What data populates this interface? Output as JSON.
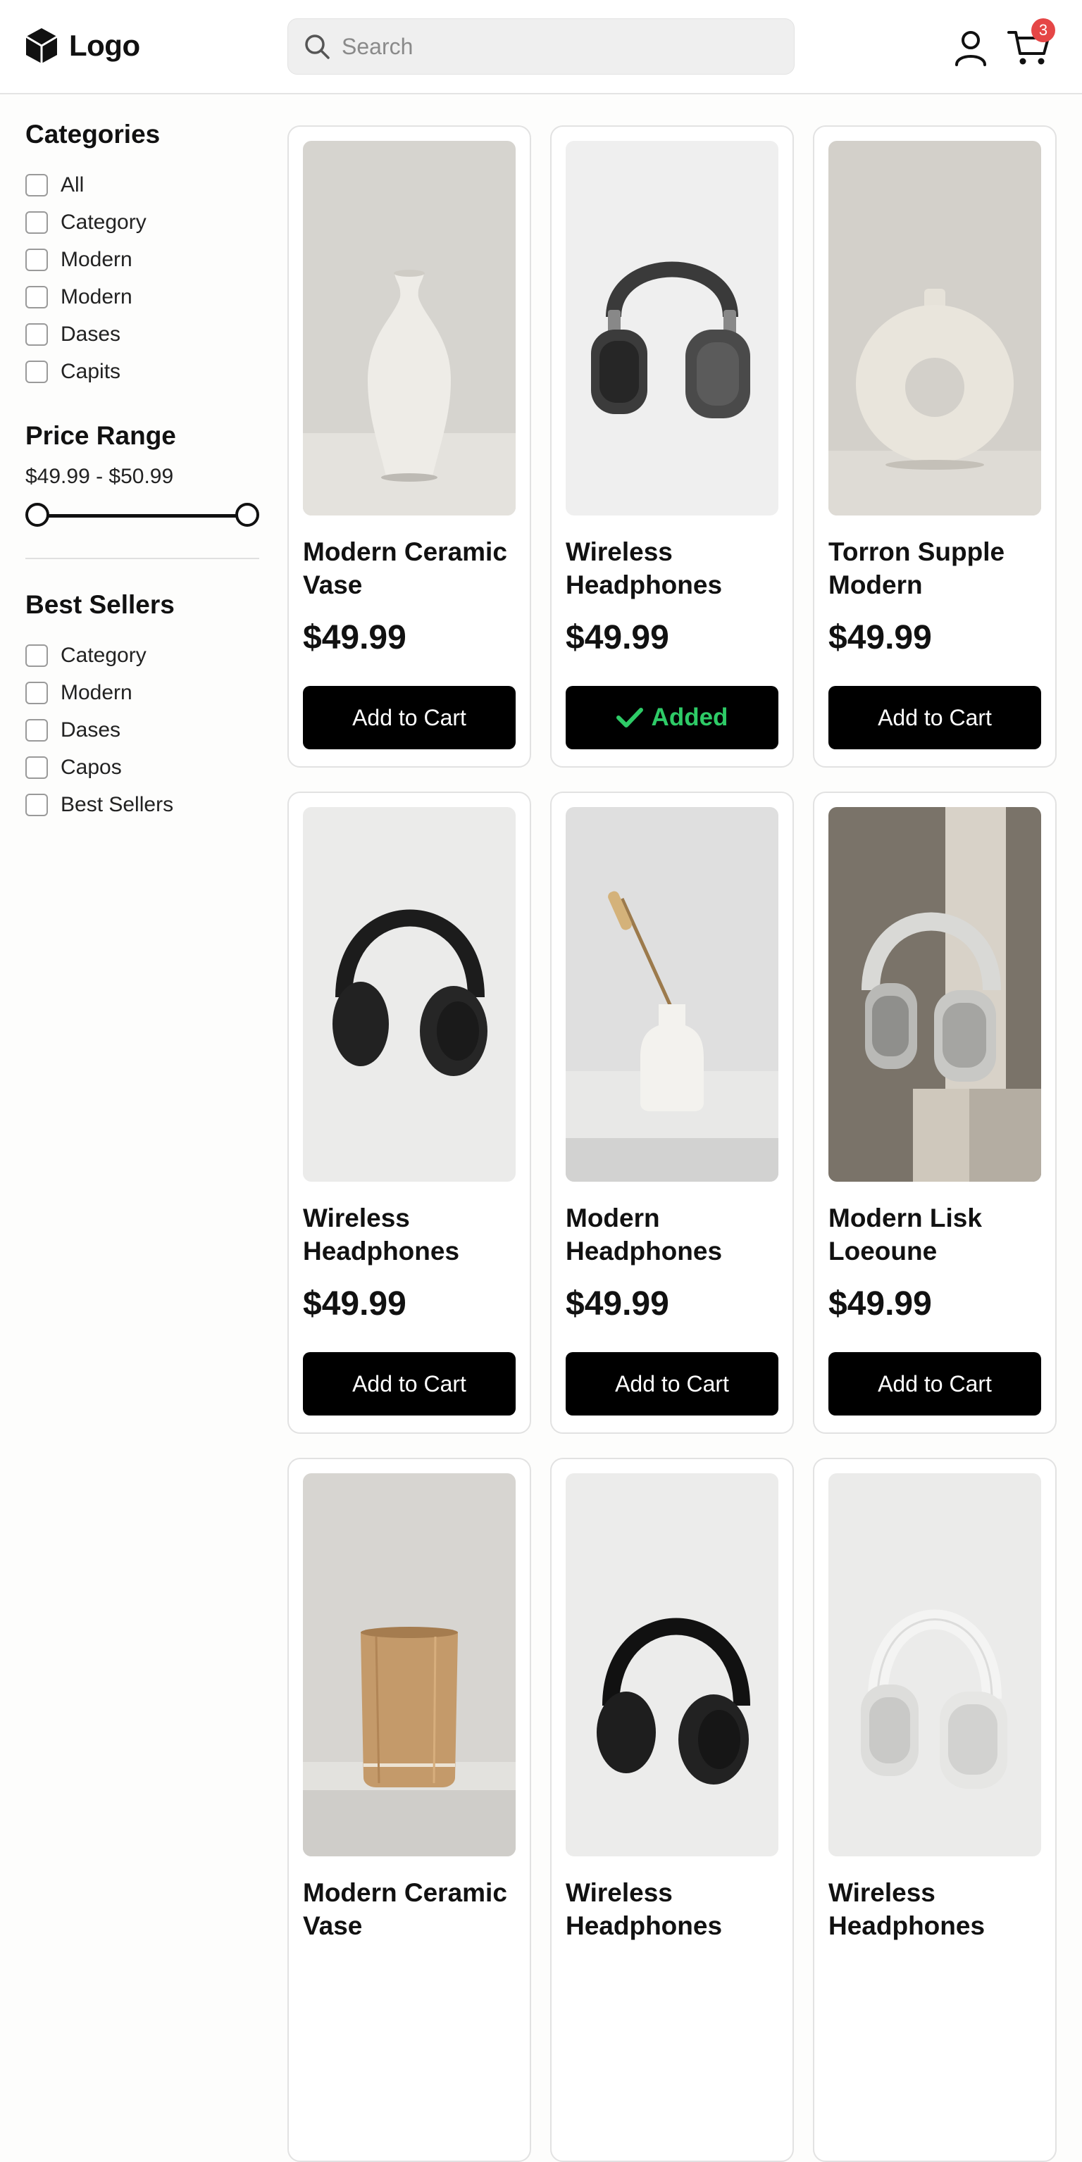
{
  "header": {
    "logo_text": "Logo",
    "search_placeholder": "Search",
    "cart_count": "3"
  },
  "sidebar": {
    "categories_title": "Categories",
    "categories": [
      "All",
      "Category",
      "Modern",
      "Modern",
      "Dases",
      "Capits"
    ],
    "price_title": "Price Range",
    "price_range": "$49.99 - $50.99",
    "best_sellers_title": "Best Sellers",
    "best_sellers": [
      "Category",
      "Modern",
      "Dases",
      "Capos",
      "Best Sellers"
    ]
  },
  "products": [
    {
      "name": "Modern Ceramic Vase",
      "price": "$49.99",
      "button": "Add to Cart",
      "image": "ceramic-vase"
    },
    {
      "name": "Wireless Headphones",
      "price": "$49.99",
      "button": "Added",
      "image": "headphones-dark-gray"
    },
    {
      "name": "Torron Supple Modern",
      "price": "$49.99",
      "button": "Add to Cart",
      "image": "donut-vase"
    },
    {
      "name": "Wireless Headphones",
      "price": "$49.99",
      "button": "Add to Cart",
      "image": "headphones-black"
    },
    {
      "name": "Modern Headphones",
      "price": "$49.99",
      "button": "Add to Cart",
      "image": "diffuser-vase"
    },
    {
      "name": "Modern Lisk Loeoune",
      "price": "$49.99",
      "button": "Add to Cart",
      "image": "headphones-silver-on-pedestal"
    },
    {
      "name": "Modern Ceramic Vase",
      "price": "",
      "button": "",
      "image": "wooden-cylinder"
    },
    {
      "name": "Wireless Headphones",
      "price": "",
      "button": "",
      "image": "headphones-black"
    },
    {
      "name": "Wireless Headphones",
      "price": "",
      "button": "",
      "image": "headphones-white"
    }
  ],
  "colors": {
    "badge": "#e54646",
    "added": "#2ecb67",
    "button": "#000000"
  }
}
